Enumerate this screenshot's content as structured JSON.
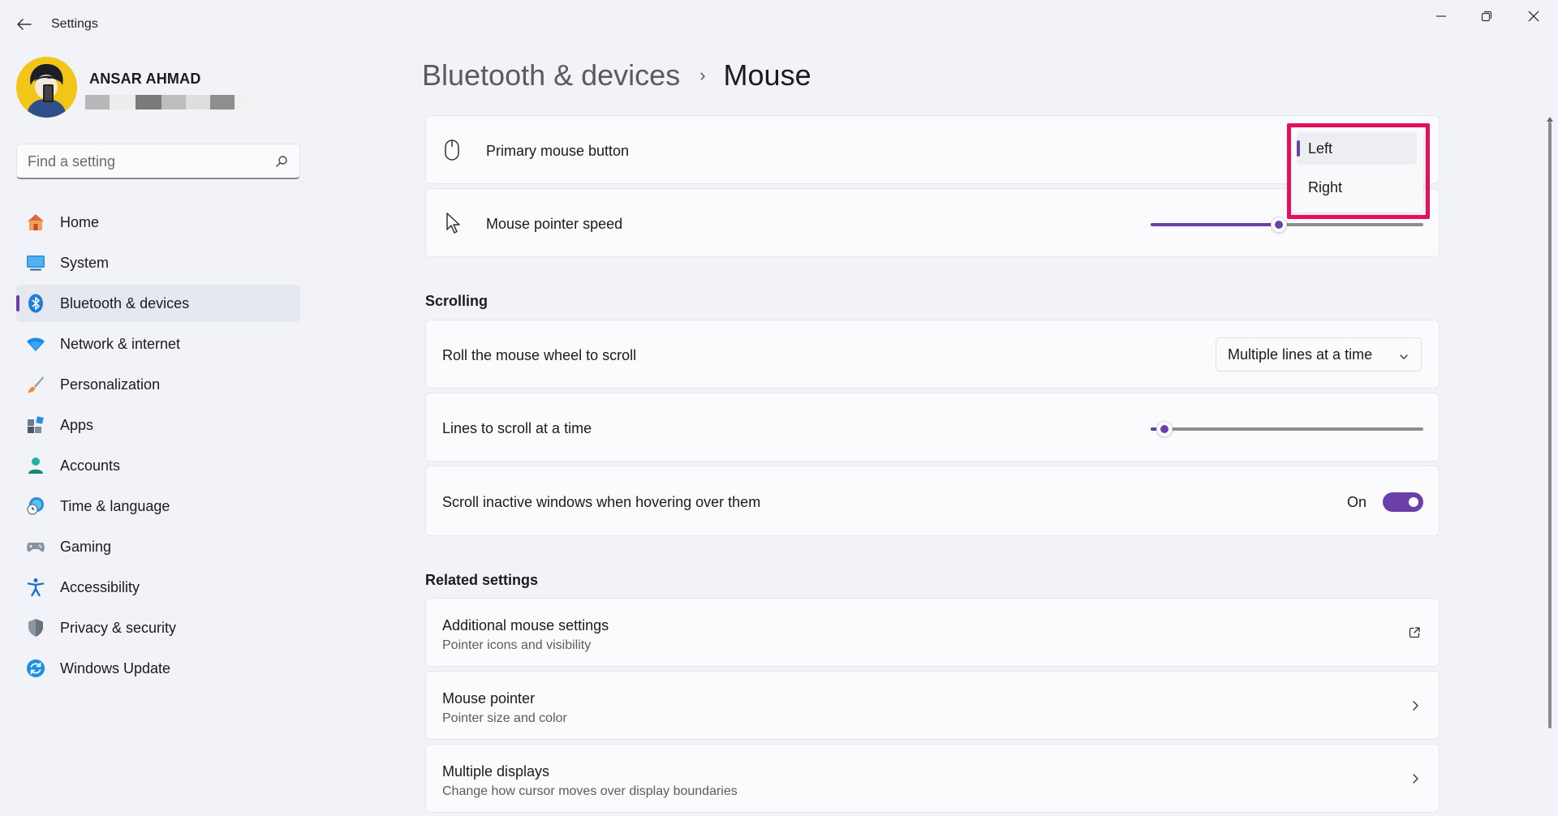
{
  "window": {
    "title": "Settings"
  },
  "profile": {
    "name": "ANSAR AHMAD"
  },
  "search": {
    "placeholder": "Find a setting"
  },
  "nav": {
    "items": [
      {
        "label": "Home",
        "icon": "home-icon"
      },
      {
        "label": "System",
        "icon": "system-icon"
      },
      {
        "label": "Bluetooth & devices",
        "icon": "bluetooth-icon",
        "active": true
      },
      {
        "label": "Network & internet",
        "icon": "wifi-icon"
      },
      {
        "label": "Personalization",
        "icon": "paintbrush-icon"
      },
      {
        "label": "Apps",
        "icon": "apps-icon"
      },
      {
        "label": "Accounts",
        "icon": "accounts-icon"
      },
      {
        "label": "Time & language",
        "icon": "time-language-icon"
      },
      {
        "label": "Gaming",
        "icon": "gamepad-icon"
      },
      {
        "label": "Accessibility",
        "icon": "accessibility-icon"
      },
      {
        "label": "Privacy & security",
        "icon": "shield-icon"
      },
      {
        "label": "Windows Update",
        "icon": "update-icon"
      }
    ]
  },
  "breadcrumb": {
    "parent": "Bluetooth & devices",
    "separator": "›",
    "current": "Mouse"
  },
  "mouse": {
    "primary_button_label": "Primary mouse button",
    "pointer_speed_label": "Mouse pointer speed",
    "pointer_speed_level": 0.47
  },
  "primary_button_menu": {
    "options": [
      "Left",
      "Right"
    ],
    "selected": "Left"
  },
  "scrolling": {
    "title": "Scrolling",
    "roll_label": "Roll the mouse wheel to scroll",
    "roll_value": "Multiple lines at a time",
    "lines_label": "Lines to scroll at a time",
    "lines_level": 0.05,
    "inactive_label": "Scroll inactive windows when hovering over them",
    "inactive_state": "On"
  },
  "related": {
    "title": "Related settings",
    "items": [
      {
        "title": "Additional mouse settings",
        "subtitle": "Pointer icons and visibility",
        "icon": "external-link-icon"
      },
      {
        "title": "Mouse pointer",
        "subtitle": "Pointer size and color",
        "icon": "chevron-right-icon"
      },
      {
        "title": "Multiple displays",
        "subtitle": "Change how cursor moves over display boundaries",
        "icon": "chevron-right-icon"
      }
    ]
  },
  "colors": {
    "accent": "#6b3fa8",
    "highlight": "#e2115d",
    "background": "#f1f3f9"
  }
}
